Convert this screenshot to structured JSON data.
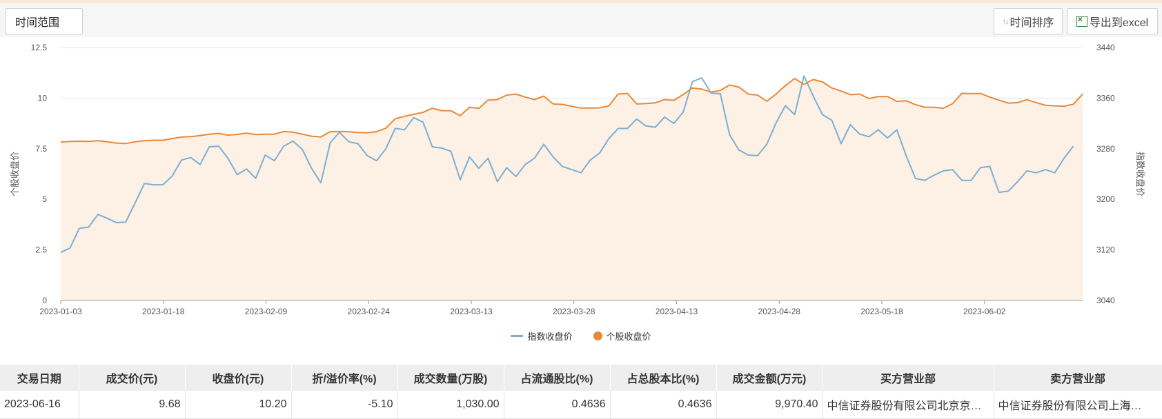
{
  "toolbar": {
    "time_range_label": "时间范围",
    "sort_label": "时间排序",
    "export_label": "导出到excel"
  },
  "chart_data": {
    "type": "line",
    "ylabel": "个股收盘价",
    "ylabel_right": "指数收盘价",
    "ylim": [
      0,
      12.5
    ],
    "ylim_right": [
      3040,
      3440
    ],
    "y_ticks": [
      "0",
      "2.5",
      "5",
      "7.5",
      "10",
      "12.5"
    ],
    "y_ticks_right": [
      "3040",
      "3120",
      "3200",
      "3280",
      "3360",
      "3440"
    ],
    "x_tick_labels": [
      "2023-01-03",
      "2023-01-18",
      "2023-02-09",
      "2023-02-24",
      "2023-03-13",
      "2023-03-28",
      "2023-04-13",
      "2023-04-28",
      "2023-05-18",
      "2023-06-02"
    ],
    "grid": true,
    "legend_position": "bottom",
    "series": [
      {
        "name": "指数收盘价",
        "axis": "right",
        "color": "#7bafd4",
        "values": [
          3116,
          3123,
          3154,
          3156,
          3176,
          3170,
          3163,
          3164,
          3194,
          3225,
          3223,
          3223,
          3237,
          3262,
          3266,
          3255,
          3283,
          3284,
          3265,
          3239,
          3248,
          3233,
          3270,
          3261,
          3284,
          3292,
          3279,
          3249,
          3226,
          3289,
          3306,
          3291,
          3288,
          3269,
          3261,
          3280,
          3312,
          3310,
          3329,
          3322,
          3283,
          3281,
          3276,
          3231,
          3267,
          3249,
          3265,
          3228,
          3250,
          3236,
          3255,
          3265,
          3287,
          3267,
          3252,
          3247,
          3242,
          3262,
          3273,
          3296,
          3312,
          3312,
          3327,
          3316,
          3314,
          3330,
          3320,
          3338,
          3386,
          3392,
          3368,
          3367,
          3302,
          3278,
          3270,
          3269,
          3287,
          3321,
          3348,
          3334,
          3395,
          3363,
          3334,
          3325,
          3288,
          3318,
          3303,
          3299,
          3310,
          3297,
          3310,
          3269,
          3233,
          3230,
          3238,
          3245,
          3247,
          3230,
          3230,
          3250,
          3252,
          3211,
          3213,
          3228,
          3245,
          3242,
          3247,
          3242,
          3265,
          3284
        ]
      },
      {
        "name": "个股收盘价",
        "axis": "left",
        "color": "#e8893a",
        "values": [
          7.83,
          7.86,
          7.87,
          7.86,
          7.9,
          7.84,
          7.78,
          7.76,
          7.84,
          7.9,
          7.92,
          7.92,
          8,
          8.08,
          8.1,
          8.15,
          8.22,
          8.26,
          8.17,
          8.21,
          8.27,
          8.2,
          8.22,
          8.22,
          8.35,
          8.32,
          8.22,
          8.12,
          8.08,
          8.34,
          8.35,
          8.34,
          8.3,
          8.29,
          8.34,
          8.52,
          8.98,
          9.1,
          9.2,
          9.3,
          9.5,
          9.38,
          9.38,
          9.13,
          9.55,
          9.5,
          9.9,
          9.93,
          10.15,
          10.2,
          10.05,
          9.93,
          10.1,
          9.71,
          9.69,
          9.6,
          9.51,
          9.51,
          9.52,
          9.62,
          10.2,
          10.23,
          9.71,
          9.73,
          9.77,
          9.93,
          9.89,
          10.18,
          10.5,
          10.45,
          10.3,
          10.38,
          10.65,
          10.55,
          10.2,
          10.15,
          9.85,
          10.2,
          10.62,
          10.97,
          10.68,
          10.92,
          10.8,
          10.5,
          10.35,
          10.17,
          10.2,
          9.98,
          10.08,
          10.08,
          9.84,
          9.87,
          9.68,
          9.55,
          9.55,
          9.5,
          9.73,
          10.24,
          10.22,
          10.23,
          10.05,
          9.9,
          9.75,
          9.78,
          9.92,
          9.78,
          9.65,
          9.62,
          9.6,
          9.7,
          10.2
        ]
      }
    ]
  },
  "table": {
    "headers": [
      "交易日期",
      "成交价(元)",
      "收盘价(元)",
      "折/溢价率(%)",
      "成交数量(万股)",
      "占流通股比(%)",
      "占总股本比(%)",
      "成交金额(万元)",
      "买方营业部",
      "卖方营业部"
    ],
    "rows": [
      [
        "2023-06-16",
        "9.68",
        "10.20",
        "-5.10",
        "1,030.00",
        "0.4636",
        "0.4636",
        "9,970.40",
        "中信证券股份有限公司北京京…",
        "中信证券股份有限公司上海…"
      ]
    ]
  }
}
